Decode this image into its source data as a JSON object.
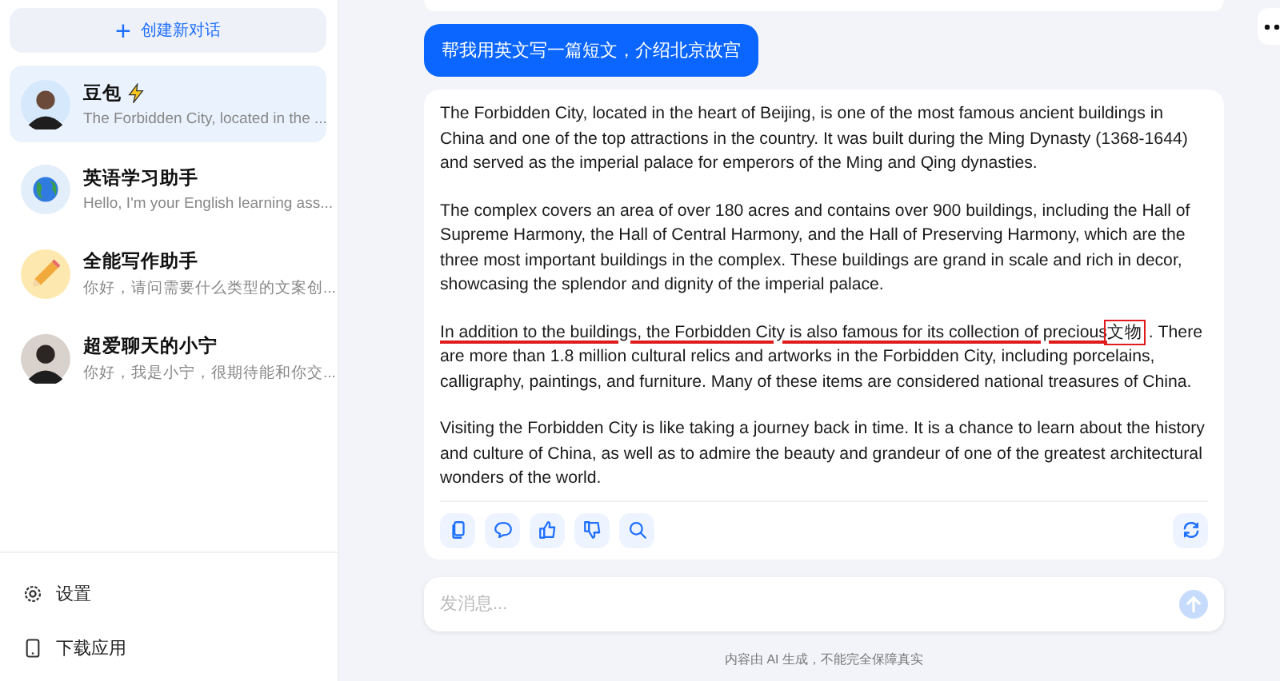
{
  "sidebar": {
    "new_chat": {
      "icon": "+",
      "label": "创建新对话"
    },
    "chats": [
      {
        "name": "豆包",
        "badge": true,
        "preview": "The Forbidden City, located in the ...",
        "kind": "person",
        "selected": true
      },
      {
        "name": "英语学习助手",
        "badge": false,
        "preview": "Hello, I'm your English learning ass...",
        "kind": "globe",
        "selected": false
      },
      {
        "name": "全能写作助手",
        "badge": false,
        "preview": "你好，请问需要什么类型的文案创...",
        "kind": "pencil",
        "selected": false
      },
      {
        "name": "超爱聊天的小宁",
        "badge": false,
        "preview": "你好，我是小宁，很期待能和你交...",
        "kind": "person",
        "selected": false
      }
    ],
    "footer": [
      {
        "kind": "settings",
        "label": "设置"
      },
      {
        "kind": "download",
        "label": "下载应用"
      }
    ]
  },
  "conversation": {
    "user_message": "帮我用英文写一篇短文，介绍北京故宫",
    "answer": [
      [
        {
          "text": "The Forbidden City, located in the heart of Beijing, is one of the most famous ancient buildings in China and one of the top attractions in the country. It was built during the Ming Dynasty (1368-1644) and served as the imperial palace for emperors of the Ming and Qing dynasties."
        }
      ],
      [
        {
          "text": "The complex covers an area of over 180 acres and contains over 900 buildings, including the Hall of Supreme Harmony, the Hall of Central Harmony, and the Hall of Preserving Harmony, which are the three most important buildings in the complex. These buildings are grand in scale and rich in decor, showcasing the splendor and dignity of the imperial palace."
        }
      ],
      [
        {
          "text": "In addition to the buildings, the Forbidden City is also famous for its collection of precious",
          "kind": "underline"
        },
        {
          "text": "文物",
          "kind": "box"
        },
        {
          "text": ". There are more than 1.8 million cultural relics and artworks in the Forbidden City, including porcelains, calligraphy, paintings, and furniture. Many of these items are considered national treasures of China."
        }
      ],
      [
        {
          "text": "Visiting the Forbidden City is like taking a journey back in time. It is a chance to learn about the history and culture of China, as well as to admire the beauty and grandeur of one of the greatest architectural wonders of the world."
        }
      ]
    ],
    "actions": [
      {
        "kind": "copy"
      },
      {
        "kind": "comment"
      },
      {
        "kind": "like"
      },
      {
        "kind": "dislike"
      },
      {
        "kind": "search"
      }
    ]
  },
  "input": {
    "placeholder": "发消息..."
  },
  "disclaimer": "内容由 AI 生成，不能完全保障真实"
}
